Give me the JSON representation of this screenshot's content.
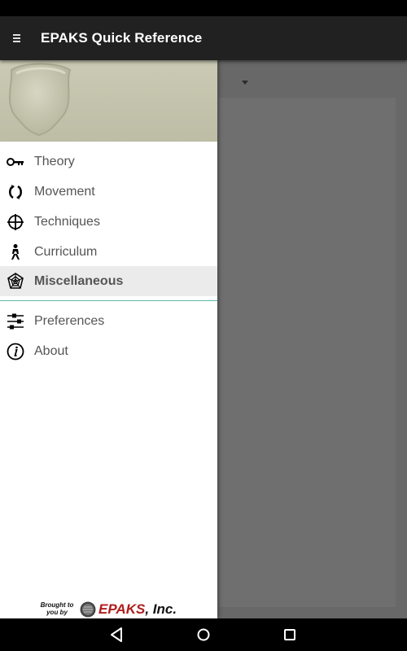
{
  "app": {
    "title": "EPAKS Quick Reference"
  },
  "drawer": {
    "items": [
      {
        "label": "Theory",
        "icon": "key-icon"
      },
      {
        "label": "Movement",
        "icon": "movement-arrows-icon"
      },
      {
        "label": "Techniques",
        "icon": "crosshair-icon"
      },
      {
        "label": "Curriculum",
        "icon": "martial-artist-icon"
      },
      {
        "label": "Miscellaneous",
        "icon": "web-icon",
        "active": true
      }
    ],
    "secondary_items": [
      {
        "label": "Preferences",
        "icon": "sliders-icon"
      },
      {
        "label": "About",
        "icon": "info-icon"
      }
    ],
    "footer": {
      "tagline": "Brought to you by",
      "company_brand": "EPAKS",
      "company_suffix": ", Inc."
    }
  },
  "colors": {
    "app_bar": "#212121",
    "active_item_bg": "#ebebeb",
    "divider": "#5fb9a9",
    "brand_red": "#b01c1c",
    "scrim": "#686868"
  }
}
